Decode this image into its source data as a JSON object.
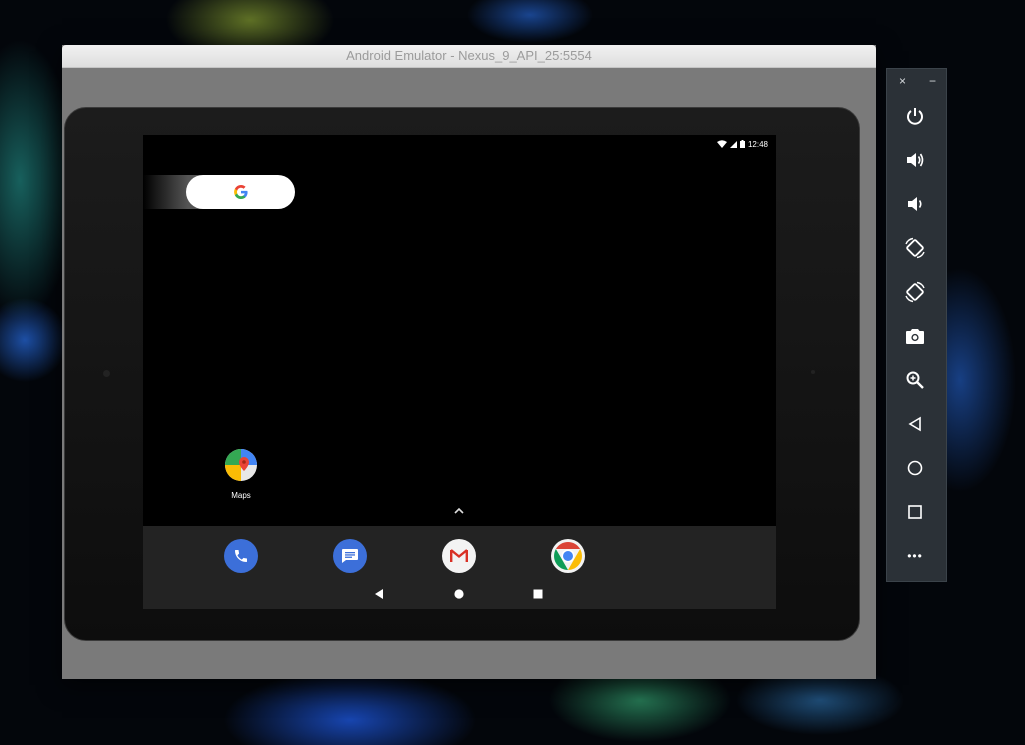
{
  "window": {
    "title": "Android Emulator - Nexus_9_API_25:5554"
  },
  "status_bar": {
    "time": "12:48"
  },
  "home": {
    "search_logo": "G",
    "apps": [
      {
        "label": "Maps",
        "icon": "maps-icon"
      }
    ],
    "all_apps_arrow": "^"
  },
  "dock": {
    "apps": [
      "phone-icon",
      "messages-icon",
      "gmail-icon",
      "chrome-icon"
    ]
  },
  "navigation": [
    "back-icon",
    "home-icon",
    "recents-icon"
  ],
  "toolbar": {
    "close_label": "×",
    "minimize_label": "−",
    "buttons": [
      "power-icon",
      "volume-up-icon",
      "volume-down-icon",
      "rotate-left-icon",
      "rotate-right-icon",
      "camera-icon",
      "zoom-icon",
      "back-icon",
      "home-icon",
      "overview-icon",
      "more-icon"
    ],
    "more_label": "•••"
  },
  "colors": {
    "toolbar_bg": "#2b3137",
    "dock_bg": "#232323",
    "google_blue": "#4285f4"
  }
}
